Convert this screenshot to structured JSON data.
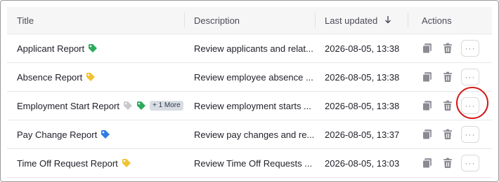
{
  "columns": {
    "title": "Title",
    "description": "Description",
    "last_updated": "Last updated",
    "actions": "Actions"
  },
  "sort_icon": "arrow-down-icon",
  "rows": [
    {
      "title": "Applicant Report",
      "description": "Review applicants and relat...",
      "updated": "2026-08-05, 13:38",
      "tags": [
        "green"
      ]
    },
    {
      "title": "Absence Report",
      "description": "Review employee absence ...",
      "updated": "2026-08-05, 13:38",
      "tags": [
        "yellow"
      ]
    },
    {
      "title": "Employment Start Report",
      "description": "Review employment starts ...",
      "updated": "2026-08-05, 13:38",
      "tags": [
        "gray",
        "green"
      ],
      "more": "+ 1 More"
    },
    {
      "title": "Pay Change Report",
      "description": "Review pay changes and re...",
      "updated": "2026-08-05, 13:37",
      "tags": [
        "blue"
      ]
    },
    {
      "title": "Time Off Request Report",
      "description": "Review Time Off Requests ...",
      "updated": "2026-08-05, 13:03",
      "tags": [
        "yellow"
      ]
    }
  ],
  "colors": {
    "green": "#2eaa5c",
    "yellow": "#f1c232",
    "gray": "#c9c9cd",
    "blue": "#2f7de1",
    "highlight": "#d11a1a"
  },
  "icons": {
    "copy": "copy-icon",
    "delete": "trash-icon",
    "more": "more-horizontal-icon"
  },
  "more_glyph": "···"
}
